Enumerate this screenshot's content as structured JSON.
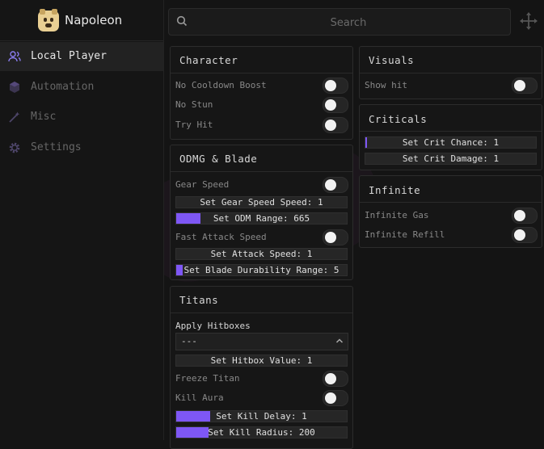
{
  "app": {
    "title": "Napoleon"
  },
  "sidebar": {
    "items": [
      {
        "label": "Local Player",
        "icon": "users-icon",
        "active": true
      },
      {
        "label": "Automation",
        "icon": "cube-icon",
        "active": false
      },
      {
        "label": "Misc",
        "icon": "wand-icon",
        "active": false
      },
      {
        "label": "Settings",
        "icon": "gear-icon",
        "active": false
      }
    ]
  },
  "search": {
    "placeholder": "Search",
    "value": ""
  },
  "colors": {
    "accent": "#7e57f5",
    "panel_bg": "#161616",
    "background": "#141414"
  },
  "panels": {
    "character": {
      "title": "Character",
      "toggles": [
        {
          "label": "No Cooldown Boost",
          "on": false
        },
        {
          "label": "No Stun",
          "on": false
        },
        {
          "label": "Try Hit",
          "on": false
        }
      ]
    },
    "odmg": {
      "title": "ODMG & Blade",
      "gear_speed": {
        "label": "Gear Speed",
        "on": false
      },
      "gear_speed_slider": {
        "label": "Set Gear Speed Speed: 1",
        "fill_percent": 0
      },
      "odm_range_slider": {
        "label": "Set ODM Range: 665",
        "fill_percent": 14
      },
      "fast_attack": {
        "label": "Fast Attack Speed",
        "on": false
      },
      "attack_speed_slider": {
        "label": "Set Attack Speed: 1",
        "fill_percent": 0
      },
      "blade_durability_slider": {
        "label": "Set Blade Durability Range: 5",
        "fill_percent": 4
      }
    },
    "titans": {
      "title": "Titans",
      "apply_hitboxes": {
        "label": "Apply Hitboxes",
        "value": "---"
      },
      "hitbox_slider": {
        "label": "Set Hitbox Value: 1",
        "fill_percent": 0
      },
      "freeze_titan": {
        "label": "Freeze Titan",
        "on": false
      },
      "kill_aura": {
        "label": "Kill Aura",
        "on": false
      },
      "kill_delay_slider": {
        "label": "Set Kill Delay: 1",
        "fill_percent": 20
      },
      "kill_radius_slider": {
        "label": "Set Kill Radius: 200",
        "fill_percent": 19
      }
    },
    "visuals": {
      "title": "Visuals",
      "show_hit": {
        "label": "Show hit",
        "on": false
      }
    },
    "criticals": {
      "title": "Criticals",
      "crit_chance_slider": {
        "label": "Set Crit Chance: 1",
        "fill_percent": 1
      },
      "crit_damage_slider": {
        "label": "Set Crit Damage: 1",
        "fill_percent": 0
      }
    },
    "infinite": {
      "title": "Infinite",
      "infinite_gas": {
        "label": "Infinite Gas",
        "on": false
      },
      "infinite_refill": {
        "label": "Infinite Refill",
        "on": false
      }
    }
  }
}
